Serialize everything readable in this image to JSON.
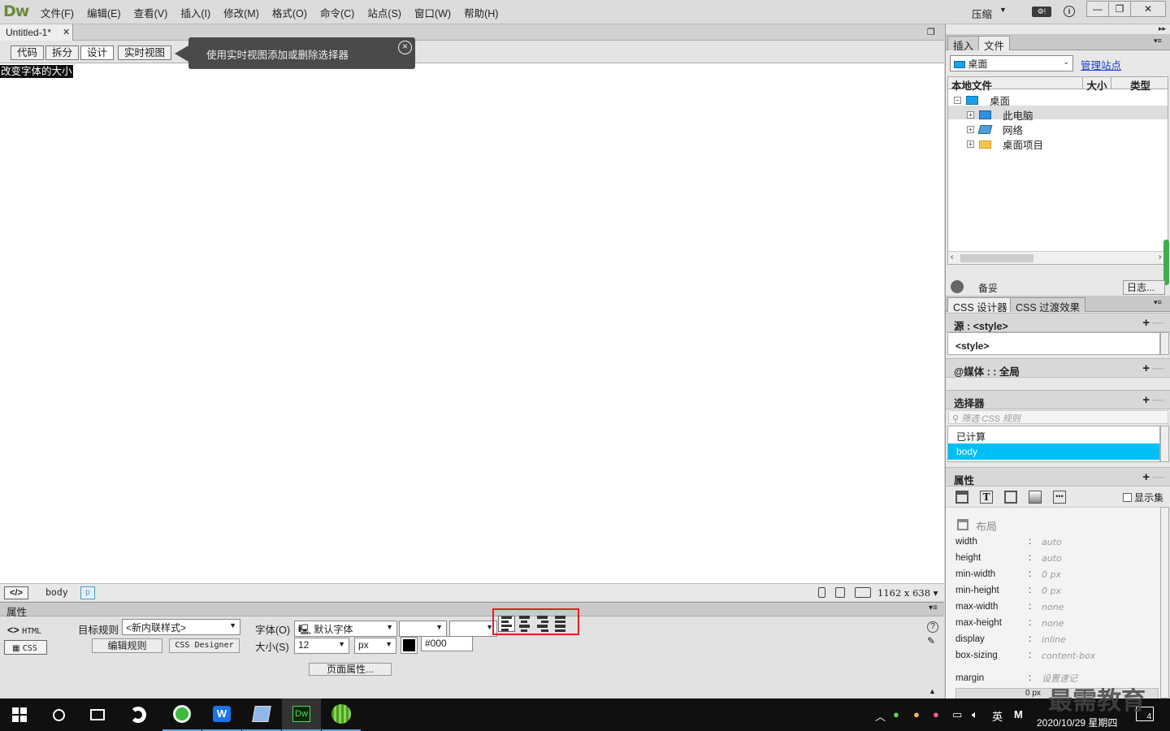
{
  "app": {
    "logo": "Dw"
  },
  "menubar": {
    "items": [
      "文件(F)",
      "编辑(E)",
      "查看(V)",
      "插入(I)",
      "修改(M)",
      "格式(O)",
      "命令(C)",
      "站点(S)",
      "窗口(W)",
      "帮助(H)"
    ],
    "workspace": "压缩",
    "win_min": "—",
    "win_restore": "❐",
    "win_close": "✕"
  },
  "document": {
    "tab_title": "Untitled-1*",
    "tab_close": "✕",
    "view_buttons": [
      "代码",
      "拆分",
      "设计",
      "实时视图"
    ],
    "active_view": "设计",
    "tooltip": "使用实时视图添加或删除选择器",
    "content_text": "改变字体的大小"
  },
  "statusbar": {
    "tag_selector_icon": "</>",
    "tag_body": "body",
    "tag_p": "p",
    "dimensions": "1162 x 638"
  },
  "properties": {
    "title": "属性",
    "html_btn": "HTML",
    "css_btn": "CSS",
    "target_rule_label": "目标规则",
    "target_rule_value": "<新内联样式>",
    "edit_rule_btn": "编辑规则",
    "css_designer_btn": "CSS Designer",
    "font_label": "字体(O)",
    "font_value": "默认字体",
    "size_label": "大小(S)",
    "size_value": "12",
    "size_unit": "px",
    "color_value": "#000",
    "page_props_btn": "页面属性...",
    "align_icons": [
      "align-left-icon",
      "align-center-icon",
      "align-right-icon",
      "align-justify-icon"
    ]
  },
  "files_panel": {
    "tabs": [
      "插入",
      "文件"
    ],
    "active_tab": "文件",
    "location": "桌面",
    "manage_sites": "管理站点",
    "columns": [
      "本地文件",
      "大小",
      "类型"
    ],
    "tree": [
      {
        "label": "桌面",
        "level": 0,
        "expander": "−"
      },
      {
        "label": "此电脑",
        "level": 1,
        "expander": "+"
      },
      {
        "label": "网络",
        "level": 1,
        "expander": "+"
      },
      {
        "label": "桌面项目",
        "level": 1,
        "expander": "+"
      }
    ],
    "status": "备妥",
    "log_btn": "日志..."
  },
  "css_designer": {
    "tabs": [
      "CSS 设计器",
      "CSS 过渡效果"
    ],
    "source_header": "源 : <style>",
    "source_item": "<style>",
    "media_header": "@媒体 : : 全局",
    "selectors_header": "选择器",
    "selector_filter_placeholder": "筛选 CSS 规则",
    "selector_items": [
      "已计算",
      "body"
    ],
    "selected_selector": "body",
    "properties_header": "属性",
    "show_set": "显示集",
    "layout_section": "布局",
    "props": [
      {
        "k": "width",
        "v": "auto"
      },
      {
        "k": "height",
        "v": "auto"
      },
      {
        "k": "min-width",
        "v": "0 px"
      },
      {
        "k": "min-height",
        "v": "0 px"
      },
      {
        "k": "max-width",
        "v": "none"
      },
      {
        "k": "max-height",
        "v": "none"
      },
      {
        "k": "display",
        "v": "inline"
      },
      {
        "k": "box-sizing",
        "v": "content-box"
      }
    ],
    "margin_label": "margin",
    "margin_value": "设置速记",
    "margin_box_value": "0 px"
  },
  "taskbar": {
    "ime_lang": "英",
    "ime_mode": "M",
    "date": "2020/10/29 星期四",
    "notification_count": "4"
  },
  "watermark": "最需教育"
}
